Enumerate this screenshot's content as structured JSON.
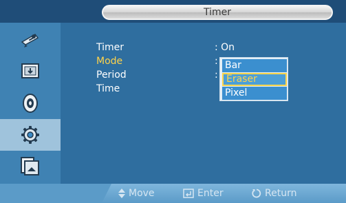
{
  "header": {
    "title": "Timer"
  },
  "sidebar": {
    "items": [
      {
        "icon": "picture-icon"
      },
      {
        "icon": "input-source-icon"
      },
      {
        "icon": "sound-icon"
      },
      {
        "icon": "setup-gear-icon"
      },
      {
        "icon": "multi-screen-icon"
      }
    ],
    "active_index": 3
  },
  "menu": {
    "rows": [
      {
        "label": "Timer",
        "value": ": On"
      },
      {
        "label": "Mode",
        "value": ":"
      },
      {
        "label": "Period",
        "value": ":"
      },
      {
        "label": "Time",
        "value": ""
      }
    ],
    "selected_index": 1
  },
  "dropdown": {
    "options": [
      "Bar",
      "Eraser",
      "Pixel"
    ],
    "highlighted": "Eraser"
  },
  "footer": {
    "move": "Move",
    "enter": "Enter",
    "return": "Return"
  },
  "colors": {
    "header_bg": "#1f4d78",
    "sidebar_bg": "#3f82b3",
    "main_bg": "#2f6e9f",
    "highlight_text": "#ffd34a",
    "footer_bg": "#5b9bc8"
  }
}
